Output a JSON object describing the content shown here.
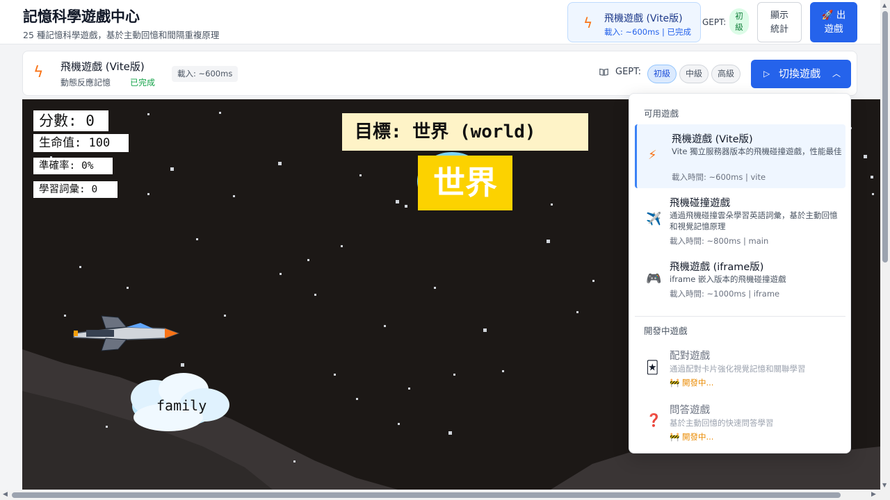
{
  "header": {
    "title": "記憶科學遊戲中心",
    "subtitle": "25 種記憶科學遊戲，基於主動回憶和間隔重複原理",
    "current_game": {
      "name": "飛機遊戲 (Vite版)",
      "meta": "載入: ~600ms | 已完成"
    },
    "gept_label": "GEPT:",
    "gept_level": "初\n級",
    "stats_button": "顯示\n統計",
    "exit_button": "🚀 出\n遊戲"
  },
  "infobar": {
    "name": "飛機遊戲 (Vite版)",
    "type": "動態反應記憶",
    "status": "已完成",
    "load": "載入: ~600ms",
    "gept_label": "GEPT:",
    "levels": [
      "初級",
      "中級",
      "高級"
    ],
    "active_level": "初級",
    "switch_button": "切換遊戲"
  },
  "game": {
    "score_label": "分數: 0",
    "life_label": "生命值: 100",
    "accuracy_label": "準確率: 0%",
    "vocab_label": "學習詞彙: 0",
    "target_label": "目標: 世界 (world)",
    "target_word": "世界",
    "cloud_word": "family"
  },
  "dropdown": {
    "available_title": "可用遊戲",
    "dev_title": "開發中遊戲",
    "available": [
      {
        "icon": "⚡",
        "title": "飛機遊戲 (Vite版)",
        "desc": "Vite 獨立服務器版本的飛機碰撞遊戲，性能最佳",
        "meta": "載入時間: ~600ms | vite"
      },
      {
        "icon": "✈️",
        "title": "飛機碰撞遊戲",
        "desc": "通過飛機碰撞雲朵學習英語詞彙，基於主動回憶和視覺記憶原理",
        "meta": "載入時間: ~800ms | main"
      },
      {
        "icon": "🎮",
        "title": "飛機遊戲 (iframe版)",
        "desc": "iframe 嵌入版本的飛機碰撞遊戲",
        "meta": "載入時間: ~1000ms | iframe"
      }
    ],
    "dev": [
      {
        "icon": "🃏",
        "title": "配對遊戲",
        "desc": "通過配對卡片強化視覺記憶和關聯學習",
        "meta": "🚧 開發中..."
      },
      {
        "icon": "❓",
        "title": "問答遊戲",
        "desc": "基於主動回憶的快速問答學習",
        "meta": "🚧 開發中..."
      }
    ]
  },
  "colors": {
    "primary": "#2563eb",
    "accent_orange": "#f97316",
    "success": "#16a34a",
    "space_bg": "#1c1816",
    "target_yellow": "#fcd200"
  }
}
